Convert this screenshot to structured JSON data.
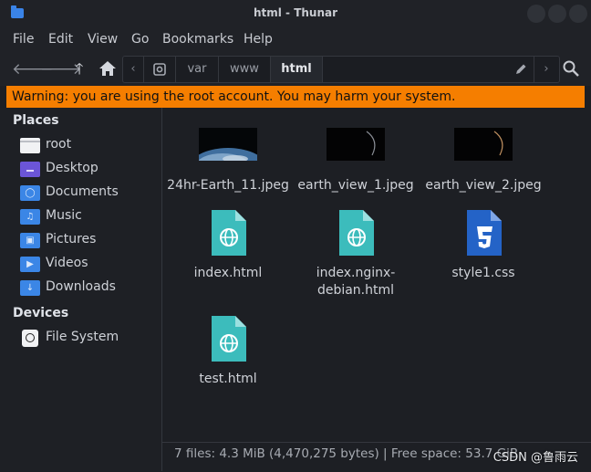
{
  "window": {
    "title": "html - Thunar"
  },
  "menubar": {
    "items": [
      "File",
      "Edit",
      "View",
      "Go",
      "Bookmarks",
      "Help"
    ]
  },
  "pathbar": {
    "segments": [
      "var",
      "www",
      "html"
    ],
    "active": "html"
  },
  "warning": {
    "text": "Warning: you are using the root account. You may harm your system."
  },
  "sidebar": {
    "places_title": "Places",
    "places": [
      {
        "label": "root",
        "icon": "home-folder-icon"
      },
      {
        "label": "Desktop",
        "icon": "desktop-folder-icon"
      },
      {
        "label": "Documents",
        "icon": "documents-folder-icon"
      },
      {
        "label": "Music",
        "icon": "music-folder-icon"
      },
      {
        "label": "Pictures",
        "icon": "pictures-folder-icon"
      },
      {
        "label": "Videos",
        "icon": "videos-folder-icon"
      },
      {
        "label": "Downloads",
        "icon": "downloads-folder-icon"
      }
    ],
    "devices_title": "Devices",
    "devices": [
      {
        "label": "File System",
        "icon": "drive-icon"
      }
    ]
  },
  "files": [
    {
      "name": "24hr-Earth_11.jpeg",
      "kind": "image"
    },
    {
      "name": "earth_view_1.jpeg",
      "kind": "image"
    },
    {
      "name": "earth_view_2.jpeg",
      "kind": "image"
    },
    {
      "name": "index.html",
      "kind": "html"
    },
    {
      "name": "index.nginx-debian.html",
      "name_lines": [
        "index.nginx-",
        "debian.html"
      ],
      "kind": "html"
    },
    {
      "name": "style1.css",
      "kind": "css"
    },
    {
      "name": "test.html",
      "kind": "html"
    }
  ],
  "status": {
    "text": "7 files: 4.3 MiB (4,470,275 bytes) | Free space: 53.7 GiB"
  },
  "watermark": {
    "text": "CSDN @鲁雨云"
  },
  "colors": {
    "warning_bg": "#f57e00",
    "folder_blue": "#3b86e6",
    "html_icon": "#3cbcbc",
    "css_icon": "#2463c7"
  }
}
